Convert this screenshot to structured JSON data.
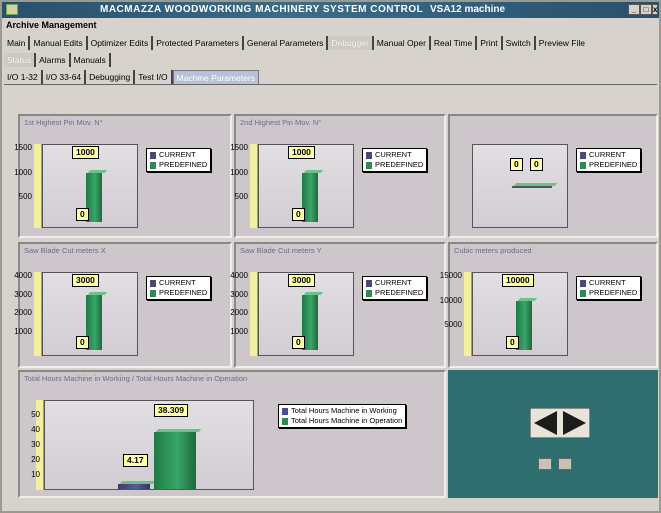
{
  "window": {
    "title": "MACMAZZA WOODWORKING MACHINERY SYSTEM CONTROL",
    "machine": "VSA12 machine",
    "controls": [
      "_",
      "□",
      "x"
    ]
  },
  "menu": {
    "label": "Archive Management"
  },
  "tabs_row1": [
    "Main",
    "Manual Edits",
    "Optimizer Edits",
    "Protected Parameters",
    "General Parameters",
    "Debugger",
    "Manual Oper",
    "Real Time",
    "Print",
    "Switch",
    "Preview File"
  ],
  "tabs_row2": [
    "Status",
    "Alarms",
    "Manuals"
  ],
  "tabs_row3": [
    "I/O 1-32",
    "I/O 33-64",
    "Debugging",
    "Test I/O",
    "Machine Parameters"
  ],
  "colors": {
    "current": "#4a4a7a",
    "predefined": "#2f8a50",
    "working": "#4a4a9a",
    "operation": "#2f8a50"
  },
  "panels": [
    {
      "title": "1st Highest Pin Mov. N°",
      "ticks": [
        "1500",
        "1000",
        "500"
      ],
      "current": "0",
      "predefined": "1000",
      "legend": [
        "CURRENT",
        "PREDEFINED"
      ]
    },
    {
      "title": "2nd Highest Pin Mov. N°",
      "ticks": [
        "1500",
        "1000",
        "500"
      ],
      "current": "0",
      "predefined": "1000",
      "legend": [
        "CURRENT",
        "PREDEFINED"
      ]
    },
    {
      "title": "",
      "ticks": [],
      "current": "0",
      "predefined": "0",
      "legend": [
        "CURRENT",
        "PREDEFINED"
      ]
    },
    {
      "title": "Saw Blade Cut meters X",
      "ticks": [
        "4000",
        "3000",
        "2000",
        "1000"
      ],
      "current": "0",
      "predefined": "3000",
      "legend": [
        "CURRENT",
        "PREDEFINED"
      ]
    },
    {
      "title": "Saw Blade Cut meters Y",
      "ticks": [
        "4000",
        "3000",
        "2000",
        "1000"
      ],
      "current": "0",
      "predefined": "3000",
      "legend": [
        "CURRENT",
        "PREDEFINED"
      ]
    },
    {
      "title": "Cubic meters produced",
      "ticks": [
        "15000",
        "10000",
        "5000"
      ],
      "current": "0",
      "predefined": "10000",
      "legend": [
        "CURRENT",
        "PREDEFINED"
      ]
    }
  ],
  "hours_panel": {
    "title": "Total Hours Machine in Working / Total Hours Machine in Operation",
    "ticks": [
      "50",
      "40",
      "30",
      "20",
      "10"
    ],
    "working": "4.17",
    "operation": "38.309",
    "legend": [
      "Total Hours Machine in Working",
      "Total Hours Machine in Operation"
    ]
  },
  "chart_data": [
    {
      "type": "bar",
      "title": "1st Highest Pin Mov. N°",
      "categories": [
        "CURRENT",
        "PREDEFINED"
      ],
      "values": [
        0,
        1000
      ],
      "ylim": [
        0,
        1500
      ]
    },
    {
      "type": "bar",
      "title": "2nd Highest Pin Mov. N°",
      "categories": [
        "CURRENT",
        "PREDEFINED"
      ],
      "values": [
        0,
        1000
      ],
      "ylim": [
        0,
        1500
      ]
    },
    {
      "type": "bar",
      "title": "",
      "categories": [
        "CURRENT",
        "PREDEFINED"
      ],
      "values": [
        0,
        0
      ]
    },
    {
      "type": "bar",
      "title": "Saw Blade Cut meters X",
      "categories": [
        "CURRENT",
        "PREDEFINED"
      ],
      "values": [
        0,
        3000
      ],
      "ylim": [
        0,
        4000
      ]
    },
    {
      "type": "bar",
      "title": "Saw Blade Cut meters Y",
      "categories": [
        "CURRENT",
        "PREDEFINED"
      ],
      "values": [
        0,
        3000
      ],
      "ylim": [
        0,
        4000
      ]
    },
    {
      "type": "bar",
      "title": "Cubic meters produced",
      "categories": [
        "CURRENT",
        "PREDEFINED"
      ],
      "values": [
        0,
        10000
      ],
      "ylim": [
        0,
        15000
      ]
    },
    {
      "type": "bar",
      "title": "Total Hours Machine in Working / Total Hours Machine in Operation",
      "categories": [
        "Total Hours Machine in Working",
        "Total Hours Machine in Operation"
      ],
      "values": [
        4.17,
        38.309
      ],
      "ylim": [
        0,
        50
      ]
    }
  ]
}
